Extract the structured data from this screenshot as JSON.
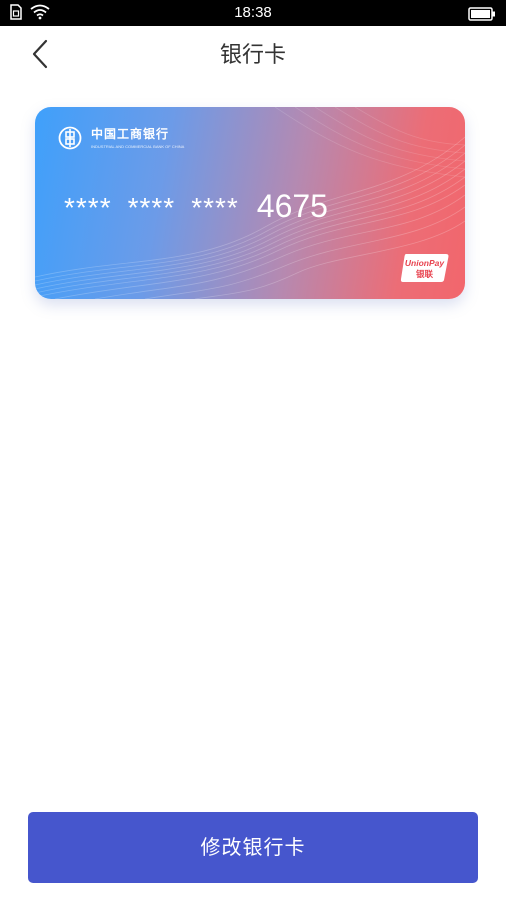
{
  "status_bar": {
    "time": "18:38",
    "icons": [
      "sim-icon",
      "wifi-icon",
      "battery-icon"
    ]
  },
  "header": {
    "back_icon": "chevron-left-icon",
    "title": "银行卡"
  },
  "card": {
    "bank_name": "中国工商银行",
    "bank_name_en": "INDUSTRIAL AND COMMERCIAL BANK OF CHINA",
    "masked_groups": [
      "****",
      "****",
      "****"
    ],
    "last_four": "4675",
    "network_logo": {
      "line1": "UnionPay",
      "line2": "银联"
    },
    "gradient_colors": [
      "#3fa0fb",
      "#f2666c"
    ]
  },
  "footer": {
    "modify_button_label": "修改银行卡",
    "button_color": "#4656cd"
  }
}
